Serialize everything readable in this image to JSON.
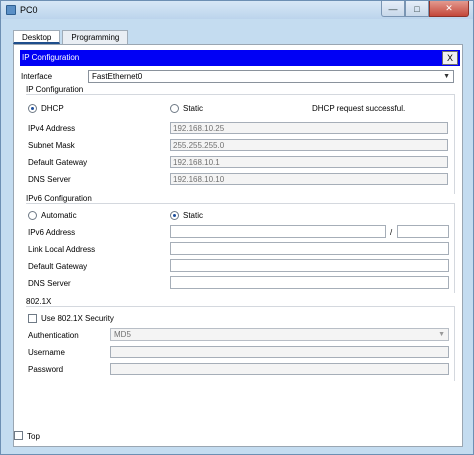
{
  "window": {
    "title": "PC0",
    "minimize": "—",
    "maximize": "□",
    "close": "✕"
  },
  "tabs": [
    {
      "label": "Desktop"
    },
    {
      "label": "Programming"
    }
  ],
  "panel": {
    "title": "IP Configuration",
    "close": "X"
  },
  "interface": {
    "label": "Interface",
    "value": "FastEthernet0"
  },
  "ipv4": {
    "section": "IP Configuration",
    "dhcp_label": "DHCP",
    "static_label": "Static",
    "status": "DHCP request successful.",
    "address_label": "IPv4 Address",
    "address": "192.168.10.25",
    "mask_label": "Subnet Mask",
    "mask": "255.255.255.0",
    "gateway_label": "Default Gateway",
    "gateway": "192.168.10.1",
    "dns_label": "DNS Server",
    "dns": "192.168.10.10"
  },
  "ipv6": {
    "section": "IPv6 Configuration",
    "automatic_label": "Automatic",
    "static_label": "Static",
    "address_label": "IPv6 Address",
    "address": "",
    "prefix_sep": "/",
    "prefix": "",
    "link_local_label": "Link Local Address",
    "link_local": "",
    "gateway_label": "Default Gateway",
    "gateway": "",
    "dns_label": "DNS Server",
    "dns": ""
  },
  "dot1x": {
    "section": "802.1X",
    "use_security_label": "Use 802.1X Security",
    "auth_label": "Authentication",
    "auth_value": "MD5",
    "username_label": "Username",
    "username": "",
    "password_label": "Password",
    "password": ""
  },
  "footer": {
    "top_label": "Top"
  }
}
